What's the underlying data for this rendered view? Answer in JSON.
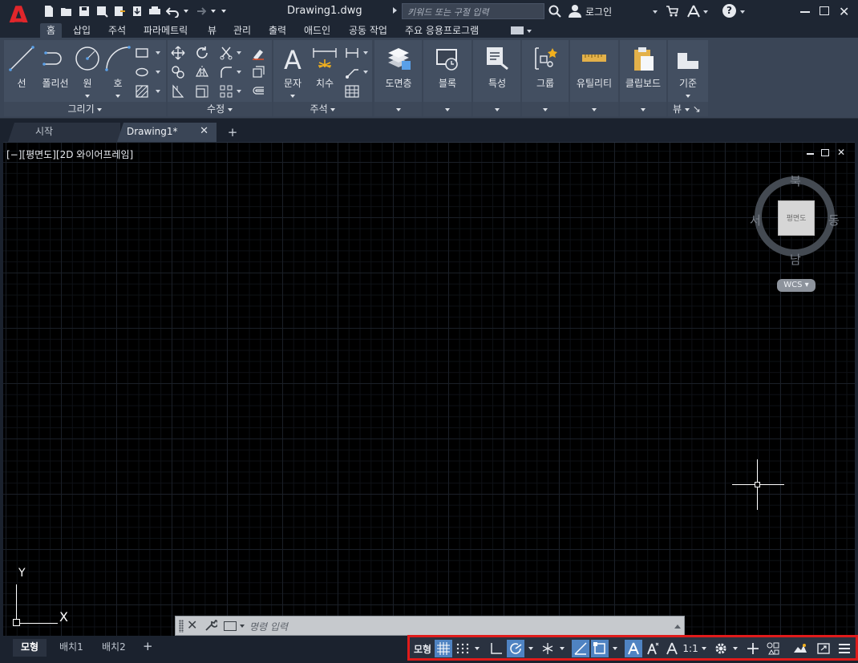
{
  "app": {
    "document_title": "Drawing1.dwg",
    "logo_letter": "A",
    "search_placeholder": "키워드 또는 구절 입력",
    "login_label": "로그인",
    "help_label": "?"
  },
  "ribbon_tabs": [
    "홈",
    "삽입",
    "주석",
    "파라메트릭",
    "뷰",
    "관리",
    "출력",
    "애드인",
    "공동 작업",
    "주요 응용프로그램"
  ],
  "ribbon": {
    "draw": {
      "title": "그리기",
      "line": "선",
      "polyline": "폴리선",
      "circle": "원",
      "arc": "호"
    },
    "modify": {
      "title": "수정"
    },
    "annotation": {
      "title": "주석",
      "text": "문자",
      "dimension": "치수"
    },
    "layers": {
      "title": "도면층"
    },
    "block": {
      "title": "블록"
    },
    "properties": {
      "title": "특성"
    },
    "groups": {
      "title": "그룹"
    },
    "utilities": {
      "title": "유틸리티"
    },
    "clipboard": {
      "title": "클립보드"
    },
    "view": {
      "base": "기준",
      "title": "뷰"
    }
  },
  "doc_tabs": {
    "start": "시작",
    "active": "Drawing1*",
    "close": "✕",
    "add": "+"
  },
  "viewport": {
    "label": "[−][평면도][2D 와이어프레임]",
    "viewcube": {
      "north": "북",
      "south": "남",
      "east": "동",
      "west": "서",
      "face": "평면도",
      "wcs": "WCS"
    },
    "ucs": {
      "x": "X",
      "y": "Y"
    }
  },
  "command_line": {
    "placeholder": "명령 입력"
  },
  "layout_tabs": [
    "모형",
    "배치1",
    "배치2"
  ],
  "statusbar": {
    "model": "모형",
    "scale": "1:1"
  },
  "colors": {
    "accent": "#4f83c2",
    "status_highlight": "#e01b1b",
    "logo": "#e0262b"
  }
}
